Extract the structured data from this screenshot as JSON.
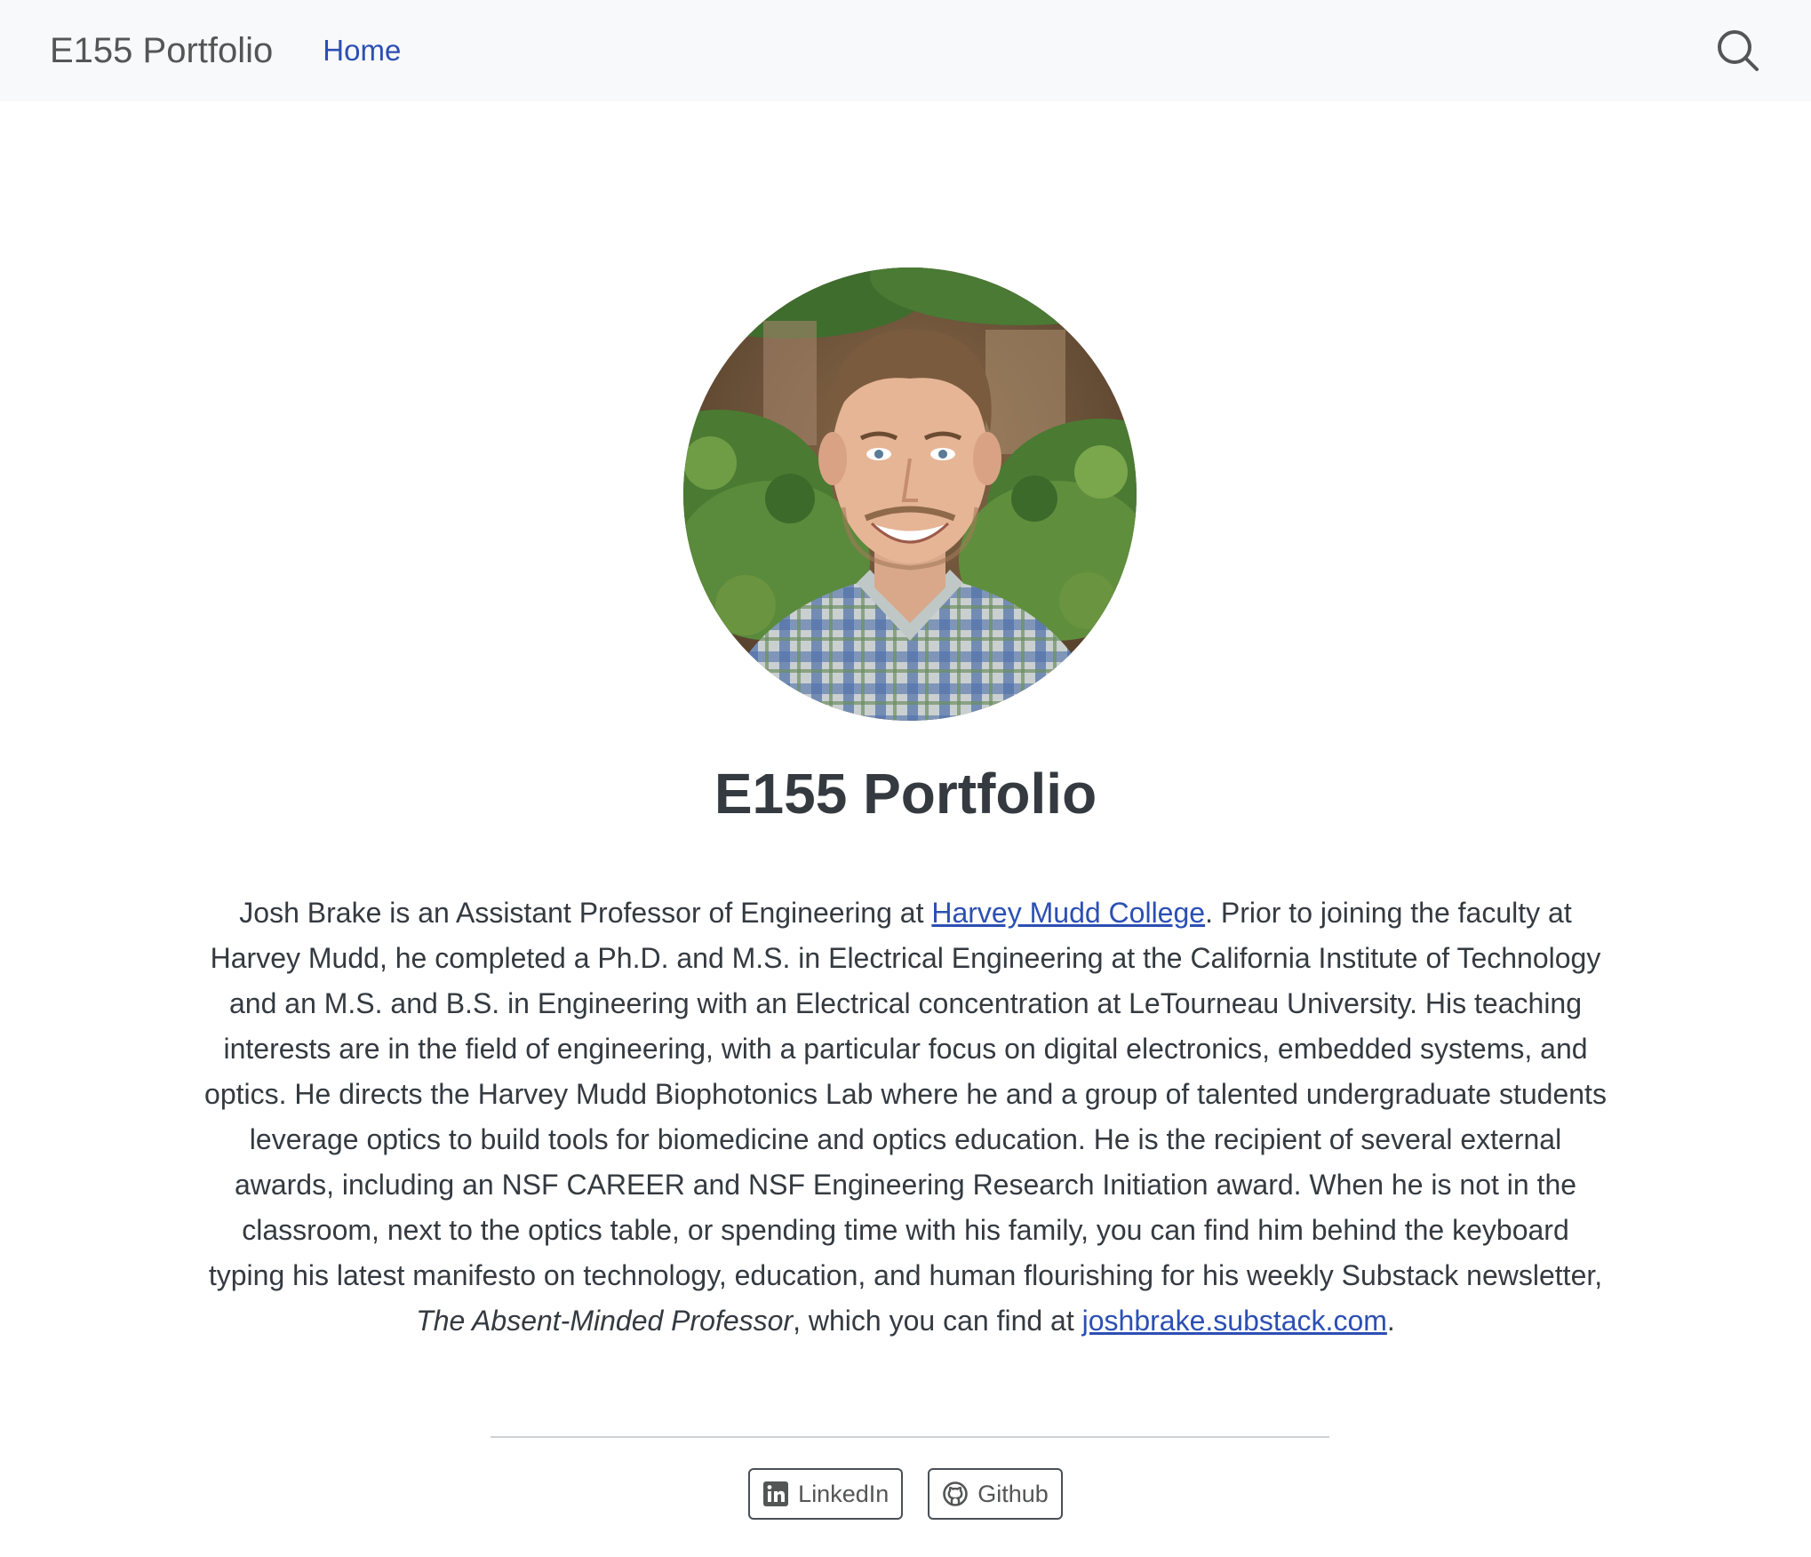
{
  "navbar": {
    "brand": "E155 Portfolio",
    "home_label": "Home",
    "search_icon": "search-icon"
  },
  "profile": {
    "photo": "portrait-photo",
    "title": "E155 Portfolio"
  },
  "bio": {
    "part1": "Josh Brake is an Assistant Professor of Engineering at ",
    "link1": "Harvey Mudd College",
    "part2": ". Prior to joining the faculty at Harvey Mudd, he completed a Ph.D. and M.S. in Electrical Engineering at the California Institute of Technology and an M.S. and B.S. in Engineering with an Electrical concentration at LeTourneau University. His teaching interests are in the field of engineering, with a particular focus on digital electronics, embedded systems, and optics. He directs the Harvey Mudd Biophotonics Lab where he and a group of talented undergraduate students leverage optics to build tools for biomedicine and optics education. He is the recipient of several external awards, including an NSF CAREER and NSF Engineering Research Initiation award. When he is not in the classroom, next to the optics table, or spending time with his family, you can find him behind the keyboard typing his latest manifesto on technology, education, and human flourishing for his weekly Substack newsletter, ",
    "italic": "The Absent-Minded Professor",
    "part3": ", which you can find at ",
    "link2": "joshbrake.substack.com",
    "part4": "."
  },
  "links": [
    {
      "label": "LinkedIn",
      "icon": "linkedin-icon"
    },
    {
      "label": "Github",
      "icon": "github-icon"
    }
  ],
  "colors": {
    "navbar_bg": "#f8f9fa",
    "link": "#2c4fb3",
    "text": "#343a40"
  }
}
